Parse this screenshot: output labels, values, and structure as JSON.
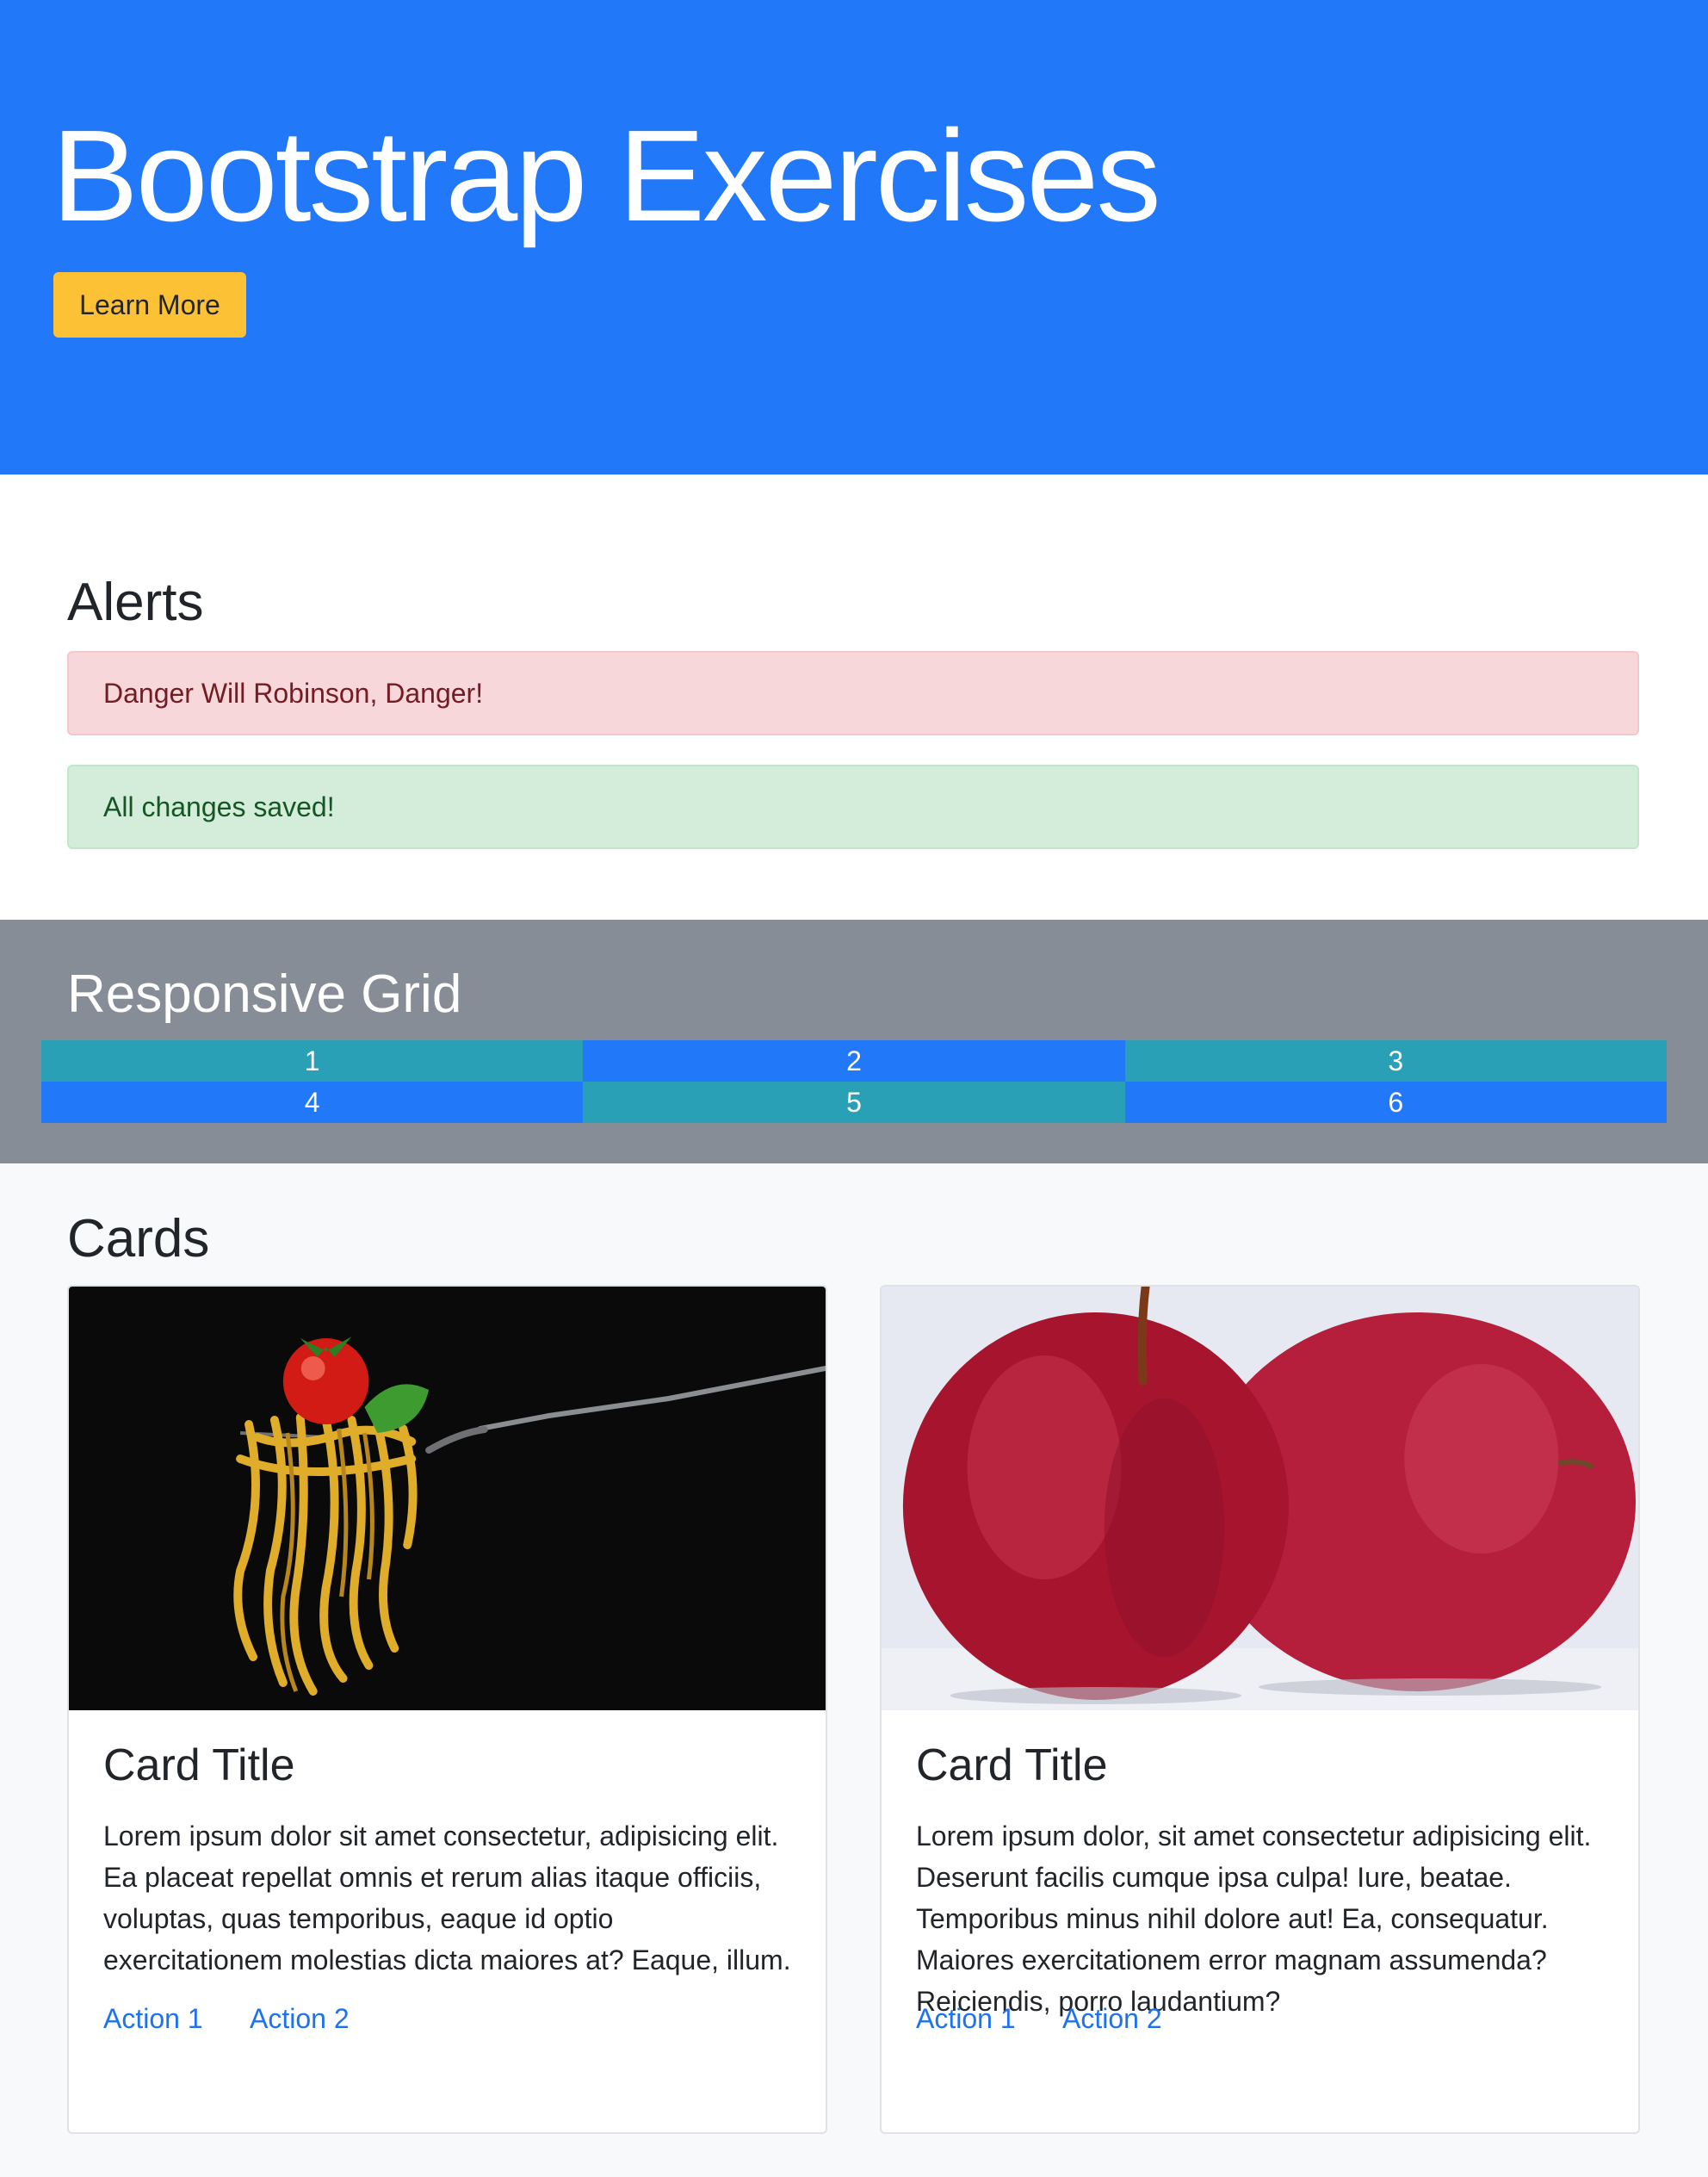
{
  "jumbotron": {
    "title": "Bootstrap Exercises",
    "button_label": "Learn More"
  },
  "alerts": {
    "title": "Alerts",
    "danger_text": "Danger Will Robinson, Danger!",
    "success_text": "All changes saved!"
  },
  "grid": {
    "title": "Responsive Grid",
    "cells": [
      "1",
      "2",
      "3",
      "4",
      "5",
      "6"
    ]
  },
  "cards": {
    "title": "Cards",
    "items": [
      {
        "title": "Card Title",
        "text": "Lorem ipsum dolor sit amet consectetur, adipisicing elit. Ea placeat repellat omnis et rerum alias itaque officiis, voluptas, quas temporibus, eaque id optio exercitationem molestias dicta maiores at? Eaque, illum.",
        "action1": "Action 1",
        "action2": "Action 2"
      },
      {
        "title": "Card Title",
        "text": "Lorem ipsum dolor, sit amet consectetur adipisicing elit. Deserunt facilis cumque ipsa culpa! Iure, beatae. Temporibus minus nihil dolore aut! Ea, consequatur. Maiores exercitationem error magnam assumenda? Reiciendis, porro laudantium?",
        "action1": "Action 1",
        "action2": "Action 2"
      }
    ]
  },
  "colors": {
    "primary": "#2178f8",
    "warning": "#fdc135",
    "info": "#2aa0b6",
    "secondary": "#868d96",
    "link": "#1d72f0"
  }
}
